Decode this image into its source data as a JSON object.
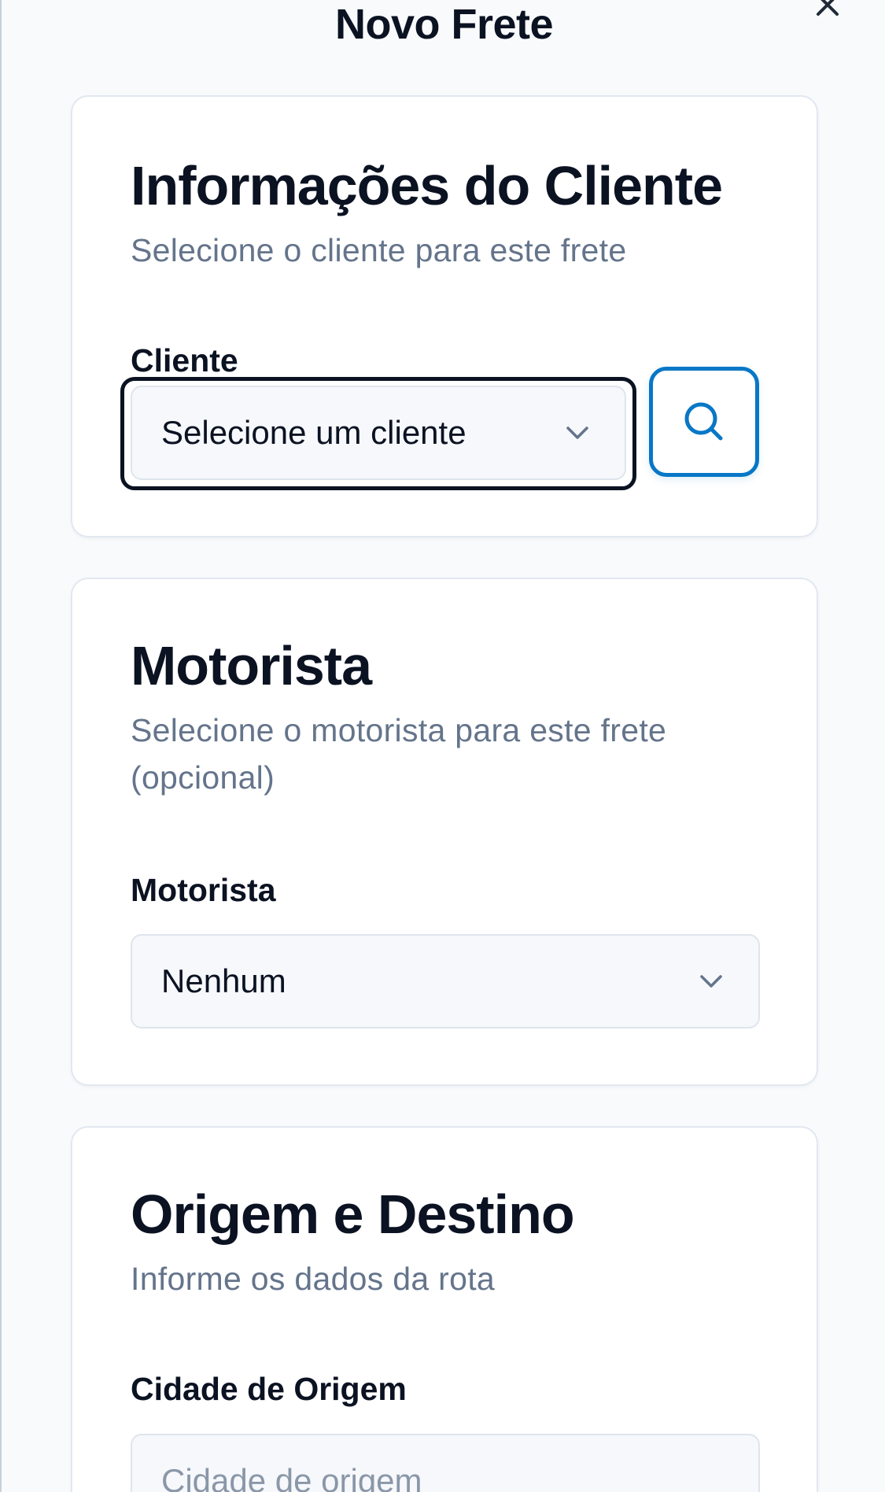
{
  "modal": {
    "title": "Novo Frete",
    "close_icon": "close-icon"
  },
  "client_section": {
    "title": "Informações do Cliente",
    "description": "Selecione o cliente para este frete",
    "field_label": "Cliente",
    "select_value": "Selecione um cliente",
    "select_icon": "chevron-down-icon",
    "search_icon": "search-icon"
  },
  "driver_section": {
    "title": "Motorista",
    "description": "Selecione o motorista para este frete (opcional)",
    "field_label": "Motorista",
    "select_value": "Nenhum",
    "select_icon": "chevron-down-icon"
  },
  "route_section": {
    "title": "Origem e Destino",
    "description": "Informe os dados da rota",
    "field_label": "Cidade de Origem",
    "input_placeholder": "Cidade de origem",
    "input_value": ""
  },
  "colors": {
    "background": "#f8fafc",
    "card": "#ffffff",
    "text_primary": "#0b1222",
    "text_muted": "#64748b",
    "accent": "#0877c6"
  }
}
